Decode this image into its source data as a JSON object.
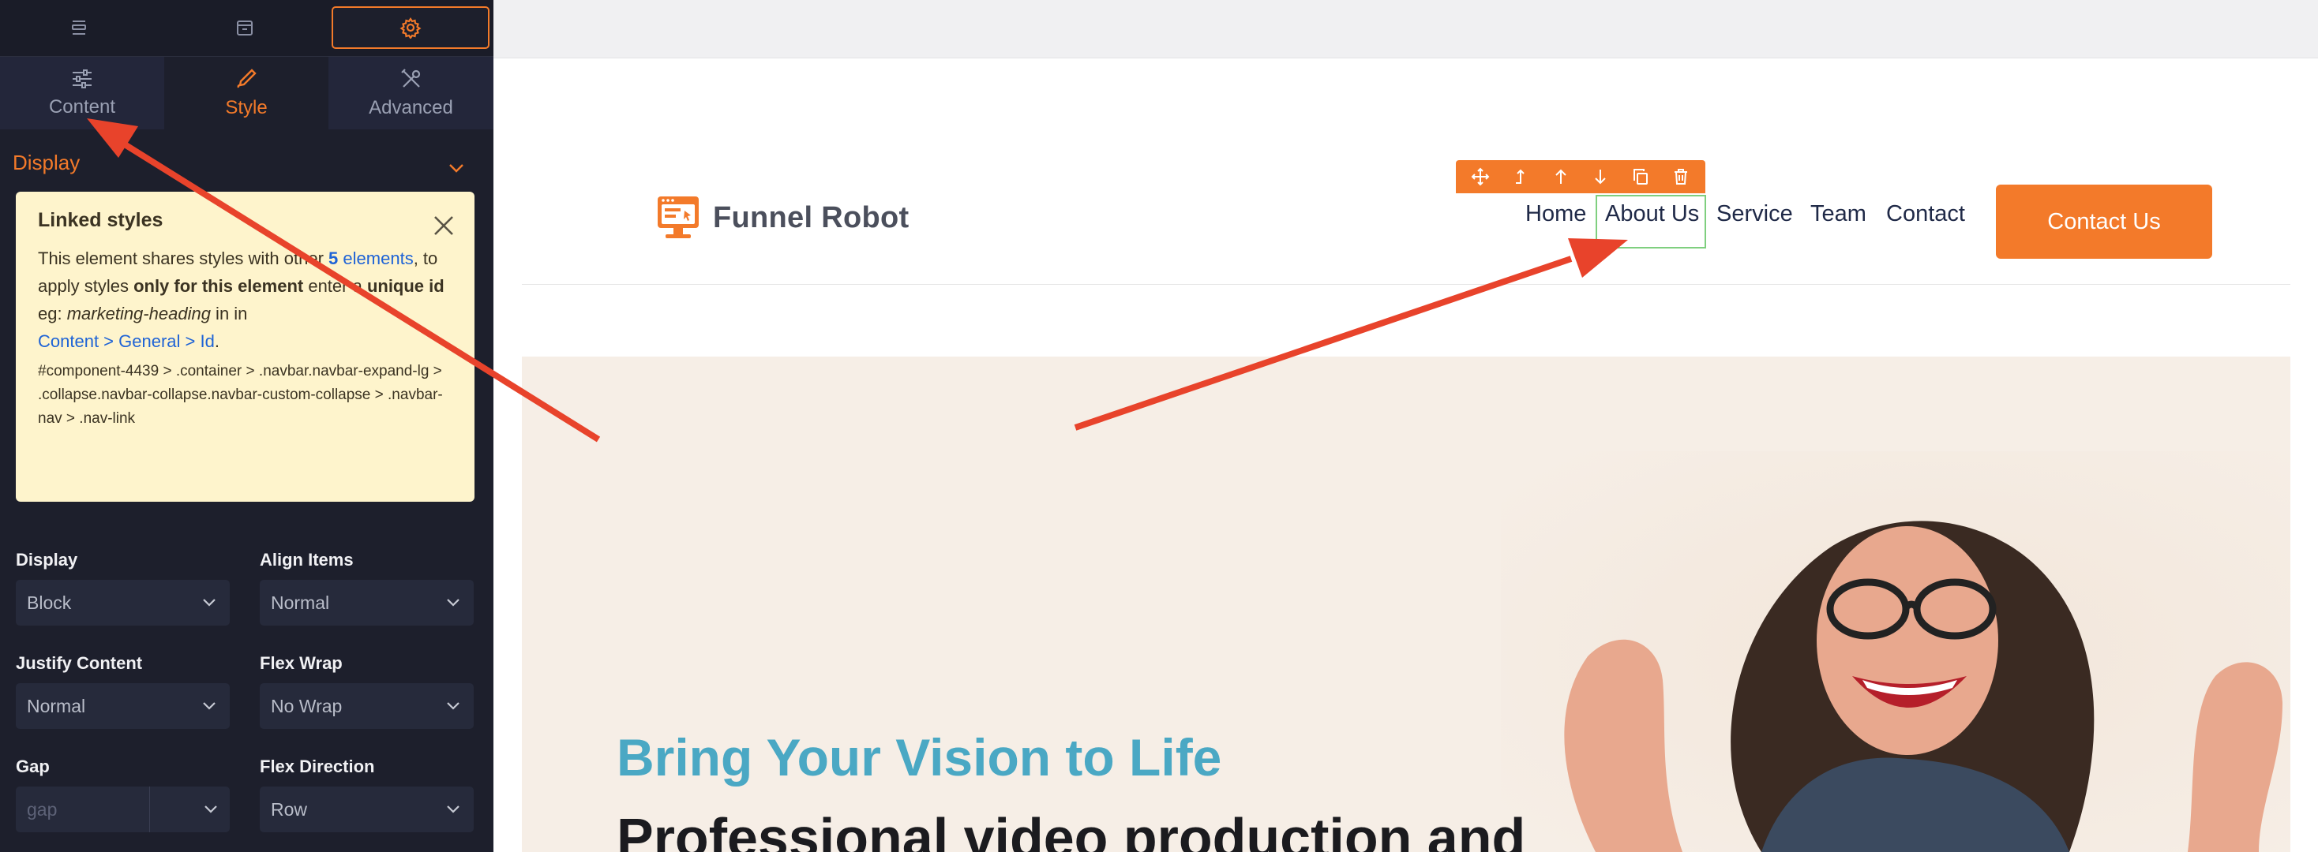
{
  "editor": {
    "topbar": {
      "layers_icon": "layers-icon",
      "archive_icon": "archive-icon",
      "settings_icon": "gear-icon"
    },
    "tabs": [
      {
        "label": "Content",
        "icon": "sliders-icon"
      },
      {
        "label": "Style",
        "icon": "pencil-icon"
      },
      {
        "label": "Advanced",
        "icon": "tools-icon"
      }
    ],
    "section": {
      "title": "Display"
    },
    "notice": {
      "title": "Linked styles",
      "p1": "This element shares styles with other ",
      "count": "5",
      "p2": "elements",
      "p3": ", to apply styles ",
      "p4": "only for this element",
      "p5": " enter a ",
      "p6": "unique id",
      "p7": " eg: ",
      "p8": "marketing-heading",
      "p9": " in in",
      "link": "Content > General > Id",
      "dot": ".",
      "path": "#component-4439 > .container > .navbar.navbar-expand-lg > .collapse.navbar-collapse.navbar-custom-collapse > .navbar-nav > .nav-link"
    },
    "fields": {
      "display": {
        "label": "Display",
        "value": "Block"
      },
      "align_items": {
        "label": "Align Items",
        "value": "Normal"
      },
      "justify_content": {
        "label": "Justify Content",
        "value": "Normal"
      },
      "flex_wrap": {
        "label": "Flex Wrap",
        "value": "No Wrap"
      },
      "gap": {
        "label": "Gap",
        "placeholder": "gap"
      },
      "flex_direction": {
        "label": "Flex Direction",
        "value": "Row"
      }
    }
  },
  "site": {
    "logo_text": "Funnel Robot",
    "nav": [
      "Home",
      "About Us",
      "Service",
      "Team",
      "Contact"
    ],
    "cta": "Contact Us",
    "hero_sub": "Bring Your Vision to Life",
    "hero_title": "Professional video production and",
    "toolbar_icons": [
      "move-icon",
      "arrow-up-parent-icon",
      "arrow-up-icon",
      "arrow-down-icon",
      "duplicate-icon",
      "trash-icon"
    ]
  },
  "colors": {
    "accent": "#f37a2a",
    "panel_bg": "#1d1f2c",
    "notice_bg": "#fef4cc",
    "nav_text": "#1f2947",
    "hero_sub": "#4aa8c4",
    "annotation_arrow": "#e8432b"
  }
}
